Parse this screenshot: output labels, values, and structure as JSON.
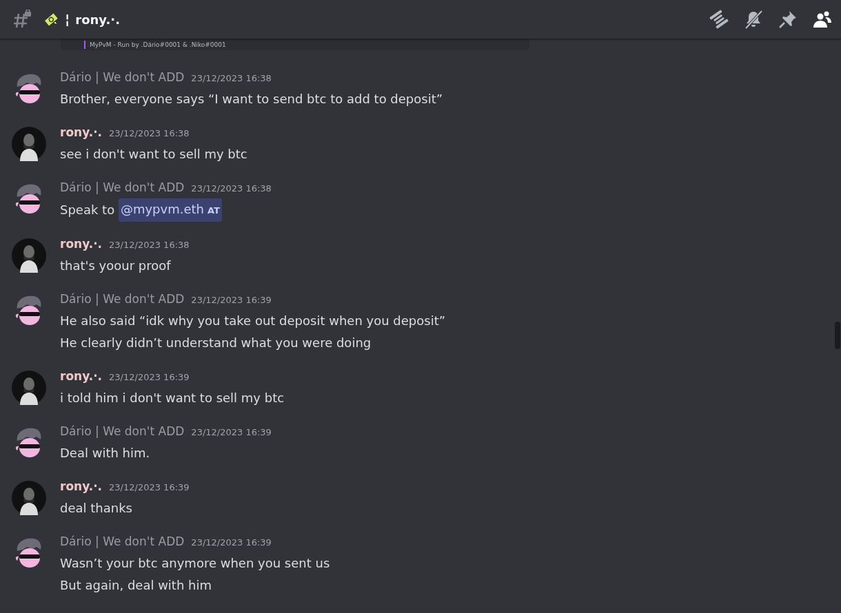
{
  "header": {
    "channel_name": "rony.·.",
    "separator": "¦"
  },
  "embed_remnant": {
    "footer": "MyPvM - Run by .Dário#0001 & .Niko#0001"
  },
  "messages": [
    {
      "author": "Dário | We don't ADD",
      "kind": "cartoon",
      "color": "#9a9ca3",
      "timestamp": "23/12/2023 16:38",
      "lines": [
        {
          "text": "Brother, everyone says “I want to send btc to add to deposit”"
        }
      ]
    },
    {
      "author": "rony.·.",
      "kind": "photo",
      "color": "#f0c8c8",
      "timestamp": "23/12/2023 16:38",
      "lines": [
        {
          "text": "see i don't want to sell my btc"
        }
      ]
    },
    {
      "author": "Dário | We don't ADD",
      "kind": "cartoon",
      "color": "#9a9ca3",
      "timestamp": "23/12/2023 16:38",
      "lines": [
        {
          "text": "Speak to ",
          "mention": "@mypvm.eth",
          "mention_tag": "AT"
        }
      ]
    },
    {
      "author": "rony.·.",
      "kind": "photo",
      "color": "#f0c8c8",
      "timestamp": "23/12/2023 16:38",
      "lines": [
        {
          "text": "that's yoour proof"
        }
      ]
    },
    {
      "author": "Dário | We don't ADD",
      "kind": "cartoon",
      "color": "#9a9ca3",
      "timestamp": "23/12/2023 16:39",
      "lines": [
        {
          "text": "He also said “idk why you take out deposit when you deposit”"
        },
        {
          "text": "He clearly didn’t understand what you were doing"
        }
      ]
    },
    {
      "author": "rony.·.",
      "kind": "photo",
      "color": "#f0c8c8",
      "timestamp": "23/12/2023 16:39",
      "lines": [
        {
          "text": "i told him i don't want to sell my btc"
        }
      ]
    },
    {
      "author": "Dário | We don't ADD",
      "kind": "cartoon",
      "color": "#9a9ca3",
      "timestamp": "23/12/2023 16:39",
      "lines": [
        {
          "text": "Deal with him."
        }
      ]
    },
    {
      "author": "rony.·.",
      "kind": "photo",
      "color": "#f0c8c8",
      "timestamp": "23/12/2023 16:39",
      "lines": [
        {
          "text": "deal thanks"
        }
      ]
    },
    {
      "author": "Dário | We don't ADD",
      "kind": "cartoon",
      "color": "#9a9ca3",
      "timestamp": "23/12/2023 16:39",
      "lines": [
        {
          "text": "Wasn’t your btc anymore when you sent us"
        },
        {
          "text": "But again, deal with him"
        }
      ]
    }
  ]
}
